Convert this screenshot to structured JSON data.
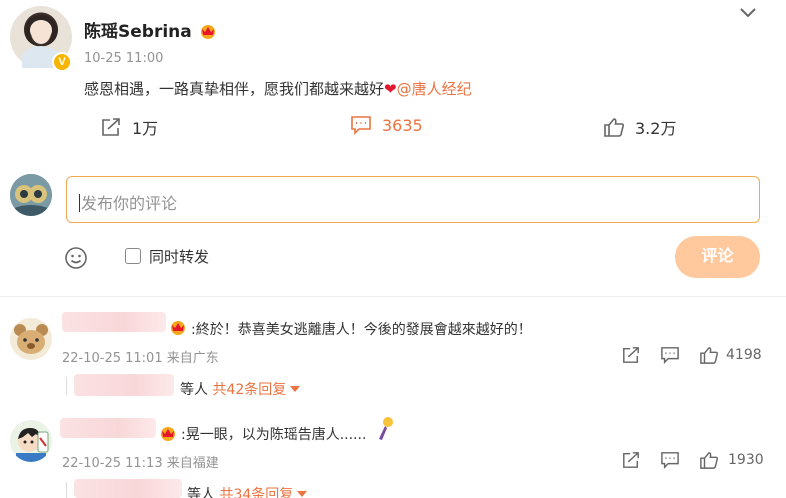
{
  "post": {
    "username": "陈瑶Sebrina",
    "time": "10-25 11:00",
    "text_main": "感恩相遇，一路真挚相伴，愿我们都越来越好",
    "heart": "❤",
    "mention": "@唐人经纪",
    "actions": {
      "repost_count": "1万",
      "comment_count": "3635",
      "like_count": "3.2万"
    }
  },
  "composer": {
    "placeholder": "发布你的评论",
    "sync_repost_label": "同时转发",
    "submit_label": "评论"
  },
  "comments": [
    {
      "text": ":終於！恭喜美女逃離唐人！今後的發展會越來越好的！",
      "time": "22-10-25 11:01",
      "location": "来自广东",
      "likes": "4198",
      "reply_suffix": "等人",
      "reply_count_label": "共42条回复"
    },
    {
      "text": ":晃一眼，以为陈瑶告唐人......",
      "time": "22-10-25 11:13",
      "location": "来自福建",
      "likes": "1930",
      "reply_suffix": "等人",
      "reply_count_label": "共34条回复"
    }
  ],
  "colors": {
    "accent": "#eb7340",
    "submit_disabled": "#ffc89d",
    "input_border": "#f1aa51",
    "muted": "#939393"
  }
}
